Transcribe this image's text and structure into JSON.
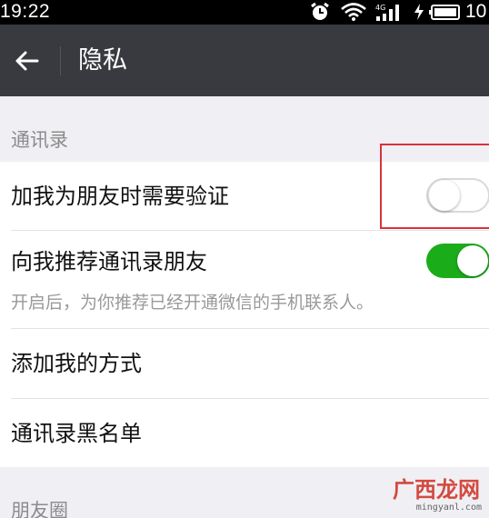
{
  "status_bar": {
    "time": "19:22",
    "battery_text": "10",
    "icons": [
      "alarm-icon",
      "wifi-icon",
      "signal-4g-icon",
      "charging-icon",
      "battery-icon"
    ]
  },
  "header": {
    "title": "隐私",
    "back_icon": "arrow-left-icon"
  },
  "sections": [
    {
      "label": "通讯录",
      "items": [
        {
          "title": "加我为朋友时需要验证",
          "control": "switch",
          "state": "off"
        },
        {
          "title": "向我推荐通讯录朋友",
          "control": "switch",
          "state": "on",
          "description": "开启后，为你推荐已经开通微信的手机联系人。"
        },
        {
          "title": "添加我的方式"
        },
        {
          "title": "通讯录黑名单"
        }
      ]
    },
    {
      "label": "朋友圈",
      "items": []
    }
  ],
  "colors": {
    "header_bg": "#393a3f",
    "switch_on": "#1aad19",
    "highlight": "#d8333b",
    "page_bg": "#efeff4"
  },
  "watermark": {
    "text": "广西龙网",
    "url": "mingyanl.com"
  }
}
